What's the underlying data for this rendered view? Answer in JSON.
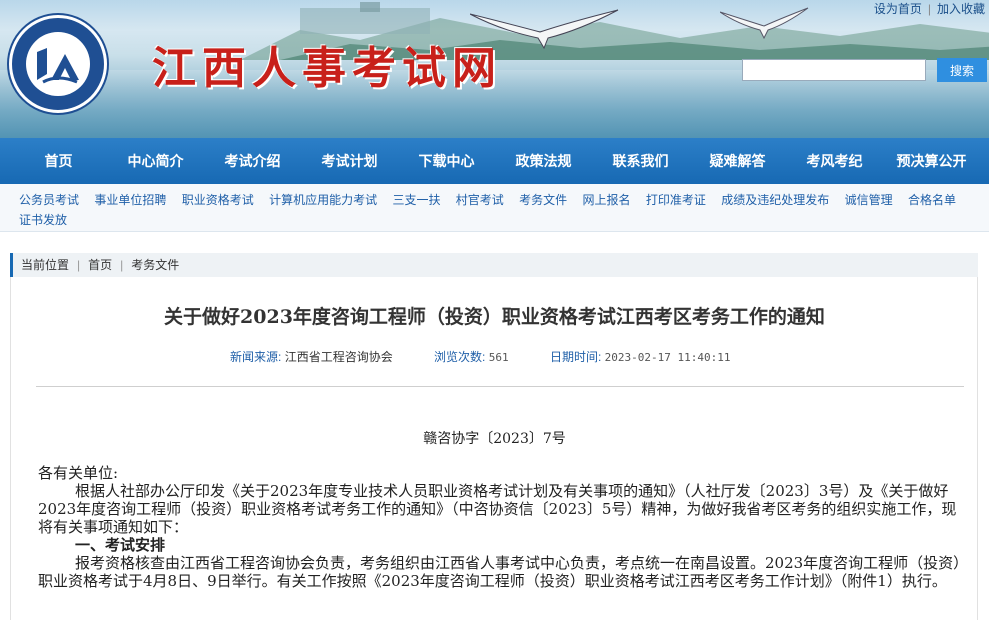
{
  "header": {
    "site_title": "江西人事考试网",
    "logo_text": "JX",
    "toplinks": [
      "设为首页",
      "加入收藏"
    ],
    "search_placeholder": "",
    "search_button": "搜索"
  },
  "main_nav": [
    "首页",
    "中心简介",
    "考试介绍",
    "考试计划",
    "下载中心",
    "政策法规",
    "联系我们",
    "疑难解答",
    "考风考纪",
    "预决算公开"
  ],
  "sub_nav": [
    "公务员考试",
    "事业单位招聘",
    "职业资格考试",
    "计算机应用能力考试",
    "三支一扶",
    "村官考试",
    "考务文件",
    "网上报名",
    "打印准考证",
    "成绩及违纪处理发布",
    "诚信管理",
    "合格名单",
    "证书发放"
  ],
  "breadcrumb": {
    "label": "当前位置",
    "items": [
      "首页",
      "考务文件"
    ]
  },
  "article": {
    "title": "关于做好2023年度咨询工程师（投资）职业资格考试江西考区考务工作的通知",
    "source_label": "新闻来源:",
    "source": "江西省工程咨询协会",
    "views_label": "浏览次数:",
    "views": "561",
    "date_label": "日期时间:",
    "date": "2023-02-17 11:40:11",
    "doc_number": "赣咨协字〔2023〕7号",
    "salutation": "各有关单位:",
    "paragraph1": "根据人社部办公厅印发《关于2023年度专业技术人员职业资格考试计划及有关事项的通知》（人社厅发〔2023〕3号）及《关于做好2023年度咨询工程师（投资）职业资格考试考务工作的通知》（中咨协资信〔2023〕5号）精神，为做好我省考区考务的组织实施工作，现将有关事项通知如下：",
    "heading1": "一、考试安排",
    "paragraph2": "报考资格核查由江西省工程咨询协会负责，考务组织由江西省人事考试中心负责，考点统一在南昌设置。2023年度咨询工程师（投资）职业资格考试于4月8日、9日举行。有关工作按照《2023年度咨询工程师（投资）职业资格考试江西考区考务工作计划》（附件1）执行。"
  },
  "colors": {
    "nav_blue": "#1769b3",
    "title_red": "#c8201a",
    "link_blue": "#1f5fa8"
  }
}
